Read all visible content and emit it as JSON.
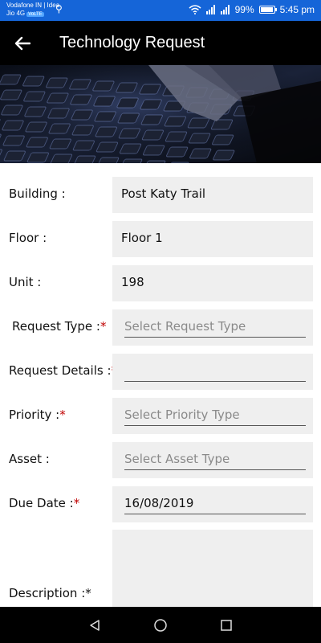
{
  "status_bar": {
    "carrier_line1": "Vodafone IN | Idea",
    "carrier_line2": "Jio 4G",
    "volte": "VoLTE",
    "battery_pct": "99%",
    "time": "5:45 pm",
    "battery_level": 0.99
  },
  "app_bar": {
    "title": "Technology Request"
  },
  "form": {
    "building": {
      "label": "Building :",
      "value": "Post Katy Trail"
    },
    "floor": {
      "label": "Floor :",
      "value": "Floor 1"
    },
    "unit": {
      "label": "Unit :",
      "value": "198"
    },
    "request_type": {
      "label": "Request Type :",
      "required": "*",
      "placeholder": "Select Request Type"
    },
    "request_details": {
      "label": "Request Details :",
      "required": "*",
      "value": ""
    },
    "priority": {
      "label": "Priority :",
      "required": "*",
      "placeholder": "Select Priority Type"
    },
    "asset": {
      "label": "Asset :",
      "placeholder": "Select Asset Type"
    },
    "due_date": {
      "label": "Due Date :",
      "required": "*",
      "value": "16/08/2019"
    },
    "description": {
      "label": "Description :",
      "required": "*",
      "value": ""
    }
  },
  "colors": {
    "status_bar": "#1565d8",
    "app_bar": "#000000",
    "required": "#c00000",
    "field_bg": "#efefef"
  }
}
